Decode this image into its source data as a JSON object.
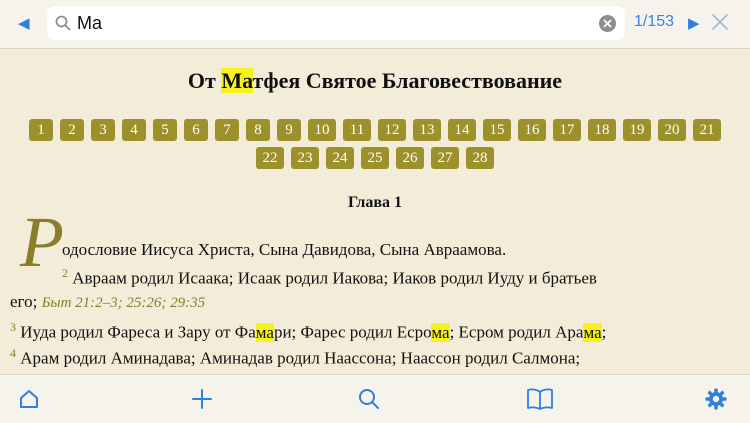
{
  "search": {
    "query": "Ma",
    "counter": "1/153",
    "prev_glyph": "◀",
    "next_glyph": "▶"
  },
  "book": {
    "title_before": "От ",
    "title_highlight": "Ма",
    "title_after": "тфея Святое Благовествование"
  },
  "chapters": {
    "row1": [
      "1",
      "2",
      "3",
      "4",
      "5",
      "6",
      "7",
      "8",
      "9",
      "10",
      "11",
      "12",
      "13",
      "14",
      "15",
      "16",
      "17",
      "18",
      "19",
      "20",
      "21"
    ],
    "row2": [
      "22",
      "23",
      "24",
      "25",
      "26",
      "27",
      "28"
    ]
  },
  "chapter_heading": "Глава 1",
  "verses": {
    "dropcap": "Р",
    "v1_text": "одословие Иисуса Христа, Сына Давидова, Сына Авраамова.",
    "v2_num": "2",
    "v2_text": " Авраам родил Исаака; Исаак родил Иакова; Иаков родил Иуду и братьев",
    "v2_cont": "его; ",
    "v2_ref": "Быт 21:2–3; 25:26; 29:35",
    "v3_num": "3",
    "v3_a": " Иуда родил Фареса и Зару от Фа",
    "v3_hl1": "ма",
    "v3_b": "ри; Фарес родил Есро",
    "v3_hl2": "ма",
    "v3_c": "; Есром родил Ара",
    "v3_hl3": "ма",
    "v3_d": ";",
    "v4_num": "4",
    "v4_text": " Арам родил Аминадава; Аминадав родил Наассона; Наассон родил Салмона;"
  },
  "colors": {
    "accent": "#2f7fe0",
    "chapter_badge": "#9c912a",
    "highlight": "#f7f21c",
    "background": "#f3ecd9"
  },
  "icons": {
    "bottom": [
      "home-icon",
      "plus-icon",
      "search-icon",
      "book-icon",
      "gear-icon"
    ]
  }
}
